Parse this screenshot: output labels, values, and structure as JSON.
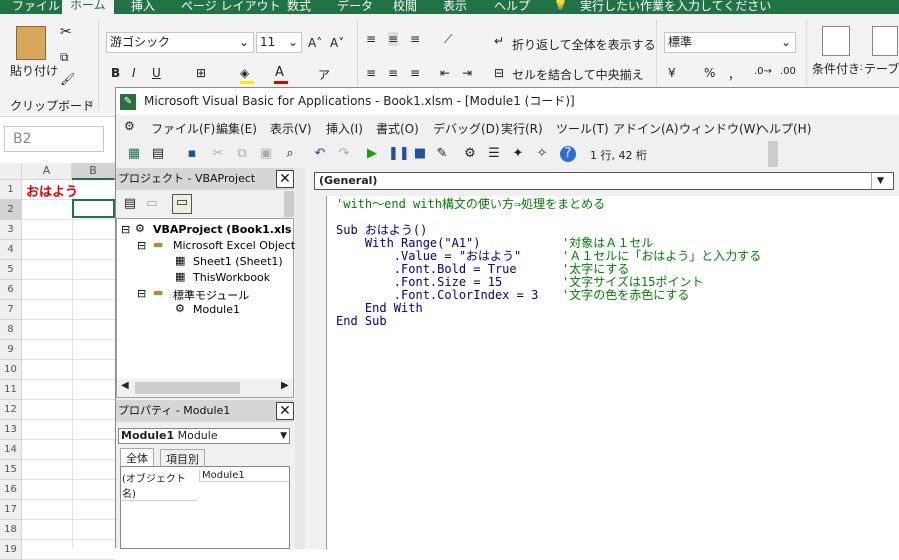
{
  "excel": {
    "tabs": [
      "ファイル",
      "ホーム",
      "挿入",
      "ページ レイアウト",
      "数式",
      "データ",
      "校閲",
      "表示",
      "ヘルプ",
      "実行したい作業を入力してください"
    ],
    "clipboard": {
      "paste_label": "貼り付け",
      "group_label": "クリップボード"
    },
    "font": {
      "name": "游ゴシック",
      "size": "11",
      "bold": "B",
      "italic": "I",
      "underline": "U"
    },
    "alignment": {
      "wrap_label": "折り返して全体を表示する",
      "merge_label": "セルを結合して中央揃え"
    },
    "number": {
      "format": "標準",
      "percent": "%",
      "comma": "，"
    },
    "styles": {
      "conditional_label": "条件付き書式",
      "table_label": "テーブル書式"
    },
    "name_box": "B2",
    "columns": [
      "A",
      "B"
    ],
    "rows": [
      "1",
      "2",
      "3",
      "4",
      "5",
      "6",
      "7",
      "8",
      "9",
      "10",
      "11",
      "12",
      "13",
      "14",
      "15",
      "16",
      "17",
      "18",
      "19"
    ],
    "cell_a1": "おはよう"
  },
  "vbe": {
    "title": "Microsoft Visual Basic for Applications - Book1.xlsm - [Module1 (コード)]",
    "menu": [
      "ファイル(F)",
      "編集(E)",
      "表示(V)",
      "挿入(I)",
      "書式(O)",
      "デバッグ(D)",
      "実行(R)",
      "ツール(T)",
      "アドイン(A)",
      "ウィンドウ(W)",
      "ヘルプ(H)"
    ],
    "cursor_pos": "1 行, 42 桁",
    "project": {
      "title": "プロジェクト - VBAProject",
      "nodes": [
        "VBAProject (Book1.xls",
        "Microsoft Excel Object",
        "Sheet1 (Sheet1)",
        "ThisWorkbook",
        "標準モジュール",
        "Module1"
      ]
    },
    "props": {
      "title": "プロパティ - Module1",
      "object_name": "Module1",
      "object_type": "Module",
      "tabs": [
        "全体",
        "項目別"
      ],
      "row_key": "(オブジェクト名)",
      "row_value": "Module1"
    },
    "object_combo": "(General)",
    "code": {
      "l0": "'with～end with構文の使い方⇒処理をまとめる",
      "l1": "Sub おはよう()",
      "l2": "    With Range(\"A1\")",
      "l2c": "'対象はＡ１セル",
      "l3": "        .Value = \"おはよう\"",
      "l3c": "'Ａ１セルに「おはよう」と入力する",
      "l4": "        .Font.Bold = True",
      "l4c": "'太字にする",
      "l5": "        .Font.Size = 15",
      "l5c": "'文字サイズは15ポイント",
      "l6": "        .Font.ColorIndex = 3",
      "l6c": "'文字の色を赤色にする",
      "l7": "    End With",
      "l8": "End Sub"
    }
  }
}
